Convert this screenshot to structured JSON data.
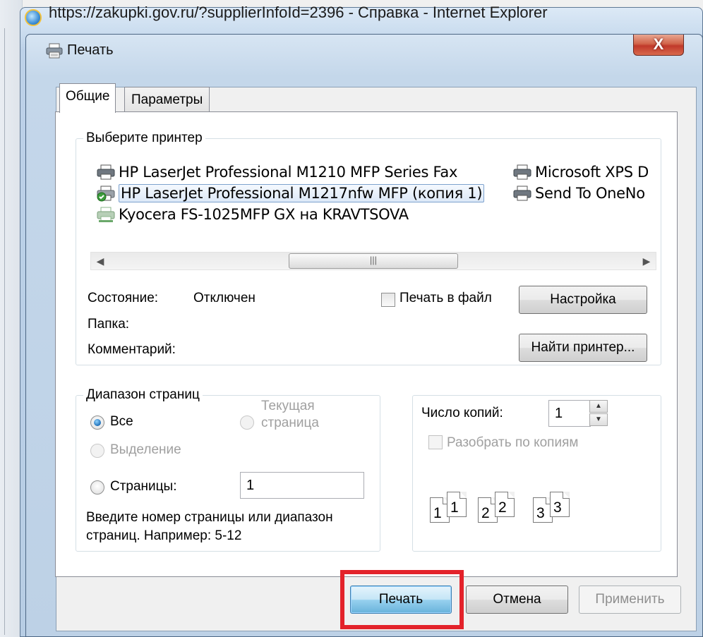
{
  "browser": {
    "title": "https://zakupki.gov.ru/?supplierInfoId=2396 - Справка - Internet Explorer"
  },
  "dialog": {
    "title": "Печать",
    "close_label": "X"
  },
  "tabs": [
    {
      "label": "Общие",
      "active": true
    },
    {
      "label": "Параметры",
      "active": false
    }
  ],
  "select_printer": {
    "group_label": "Выберите принтер",
    "printers": [
      {
        "name": "HP LaserJet Professional M1210 MFP Series Fax",
        "selected": false
      },
      {
        "name": "HP LaserJet Professional M1217nfw MFP (копия 1)",
        "selected": true
      },
      {
        "name": "Kyocera FS-1025MFP GX на KRAVTSOVA",
        "selected": false
      },
      {
        "name": "Microsoft XPS D",
        "selected": false
      },
      {
        "name": "Send To OneNo",
        "selected": false
      }
    ],
    "status_label": "Состояние:",
    "status_value": "Отключен",
    "folder_label": "Папка:",
    "comment_label": "Комментарий:",
    "print_to_file_label": "Печать в файл",
    "setup_button": "Настройка",
    "find_printer_button": "Найти принтер..."
  },
  "page_range": {
    "group_label": "Диапазон страниц",
    "all_label": "Все",
    "current_page_label_1": "Текущая",
    "current_page_label_2": "страница",
    "selection_label": "Выделение",
    "pages_label": "Страницы:",
    "pages_value": "1",
    "hint_line_1": "Введите номер страницы или диапазон",
    "hint_line_2": "страниц.  Например: 5-12",
    "selected": "all"
  },
  "copies": {
    "label": "Число копий:",
    "value": "1",
    "collate_label": "Разобрать по копиям",
    "collate_icons": [
      "1",
      "1",
      "2",
      "2",
      "3",
      "3"
    ]
  },
  "footer": {
    "print_button": "Печать",
    "cancel_button": "Отмена",
    "apply_button": "Применить"
  },
  "colors": {
    "highlight": "#e3222a",
    "dialog_frame": "#c4d7ea"
  }
}
